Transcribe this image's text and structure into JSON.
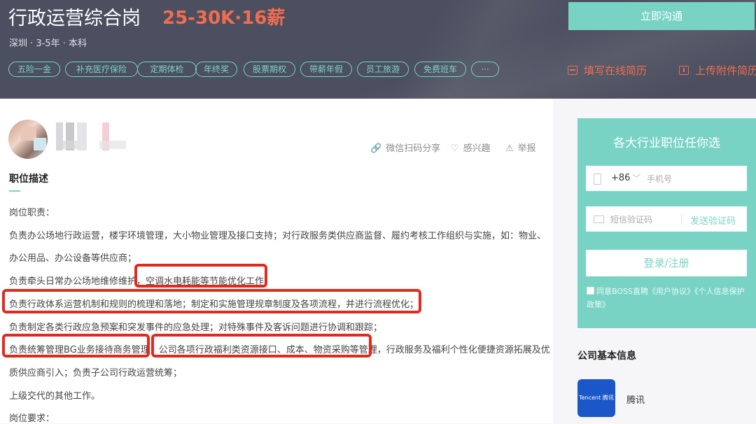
{
  "header": {
    "job_title": "行政运营综合岗",
    "salary": "25-30K·16薪",
    "meta": "深圳 · 3-5年 · 本科",
    "tags": [
      "五险一金",
      "补充医疗保险",
      "定期体检",
      "年终奖",
      "股票期权",
      "带薪年假",
      "员工旅游",
      "免费班车",
      "···"
    ],
    "chat_button": "立即沟通",
    "fill_resume": "填写在线简历",
    "upload_resume": "上传附件简历"
  },
  "actions": {
    "share": "微信扫码分享",
    "interest": "感兴趣",
    "report": "举报"
  },
  "description": {
    "title": "职位描述",
    "lines": [
      "岗位职责：",
      "负责办公场地行政运营，楼宇环境管理，大小物业管理及接口支持；对行政服务类供应商监督、履约考核工作组织与实施，如：物业、",
      "办公用品、办公设备等供应商；",
      "负责牵头日常办公场地维修维护，空调水电耗能等节能优化工作；",
      "负责行政体系运营机制和规则的梳理和落地；制定和实施管理规章制度及各项流程，并进行流程优化；",
      "负责制定各类行政应急预案和突发事件的应急处理；对特殊事件及客诉问题进行协调和跟踪；",
      "负责统筹管理BG业务接待商务管理，公司各项行政福利类资源接口、成本、物资采购等管理，行政服务及福利个性化便捷资源拓展及优",
      "质供应商引入；负责子公司行政运营统筹；",
      "上级交代的其他工作。",
      "岗位要求："
    ]
  },
  "login": {
    "title": "各大行业职位任你选",
    "country_code": "+86",
    "phone_placeholder": "手机号",
    "code_placeholder": "短信验证码",
    "send_code": "发送验证码",
    "login_button": "登录/注册",
    "agreement": "同意BOSS直聘《用户协议》《个人信息保护政策》"
  },
  "company": {
    "section_title": "公司基本信息",
    "logo_text": "Tencent 腾讯",
    "name": "腾讯"
  },
  "colors": {
    "accent": "#79d3c5",
    "salary": "#f26d4f",
    "header_bg": "#4b4f5f",
    "highlight": "#e12a1d",
    "tencent_blue": "#1b57c8"
  }
}
